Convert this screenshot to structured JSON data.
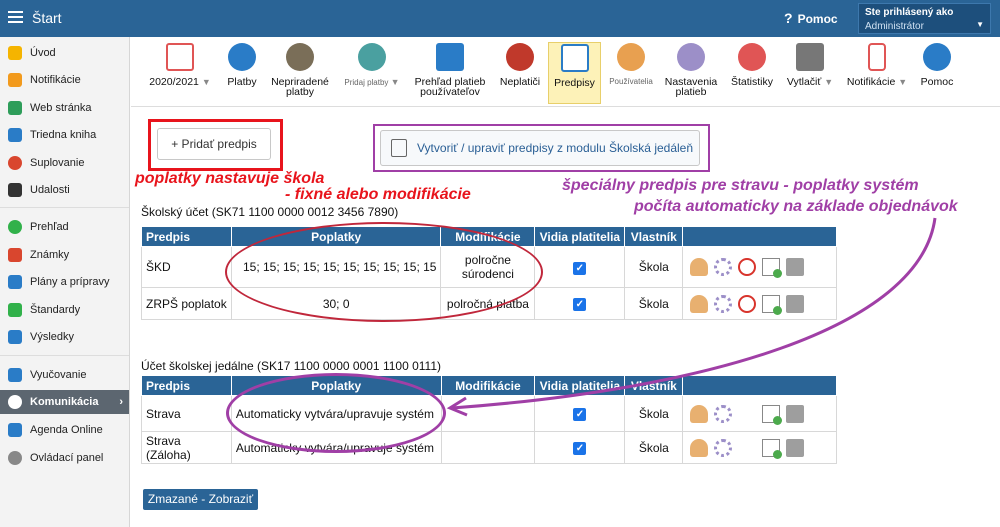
{
  "header": {
    "title": "Štart",
    "help": "Pomoc",
    "user_label": "Ste prihlásený ako",
    "user_name": "Administrátor"
  },
  "sidebar": {
    "items": [
      {
        "label": "Úvod",
        "icon": "star-icon",
        "color": "#f5b400"
      },
      {
        "label": "Notifikácie",
        "icon": "envelope-icon",
        "color": "#f29a1d"
      },
      {
        "label": "Web stránka",
        "icon": "home-icon",
        "color": "#2e9d5a"
      },
      {
        "label": "Triedna kniha",
        "icon": "book-icon",
        "color": "#2a7cc7"
      },
      {
        "label": "Suplovanie",
        "icon": "person-icon",
        "color": "#d9462e"
      },
      {
        "label": "Udalosti",
        "icon": "calendar-icon",
        "color": "#333333"
      },
      {
        "label": "Prehľad",
        "icon": "check-circle-icon",
        "color": "#31b14a"
      },
      {
        "label": "Známky",
        "icon": "grade-icon",
        "color": "#d9462e"
      },
      {
        "label": "Plány a prípravy",
        "icon": "briefcase-icon",
        "color": "#2a7cc7"
      },
      {
        "label": "Štandardy",
        "icon": "shield-icon",
        "color": "#31b14a"
      },
      {
        "label": "Výsledky",
        "icon": "bar-chart-icon",
        "color": "#2a7cc7"
      },
      {
        "label": "Vyučovanie",
        "icon": "classroom-icon",
        "color": "#2a7cc7"
      },
      {
        "label": "Komunikácia",
        "icon": "chat-icon",
        "color": "#ffffff"
      },
      {
        "label": "Agenda Online",
        "icon": "pen-icon",
        "color": "#2a7cc7"
      },
      {
        "label": "Ovládací panel",
        "icon": "gear-icon",
        "color": "#888888"
      }
    ]
  },
  "toolbar": {
    "items": [
      {
        "label": "2020/2021",
        "icon": "calendar-icon",
        "color": "#e05555"
      },
      {
        "label": "Platby",
        "icon": "money-bag-icon",
        "color": "#2a7cc7"
      },
      {
        "label": "Nepriradené platby",
        "icon": "question-bag-icon",
        "color": "#7a6e58"
      },
      {
        "label": "Pridaj platby",
        "icon": "add-money-icon",
        "color": "#4aa0a0"
      },
      {
        "label": "Prehľad platieb používateľov",
        "icon": "ledger-icon",
        "color": "#2a7cc7"
      },
      {
        "label": "Neplatiči",
        "icon": "debt-bag-icon",
        "color": "#c0392b"
      },
      {
        "label": "Predpisy",
        "icon": "document-icon",
        "color": "#2a7cc7"
      },
      {
        "label": "Používatelia",
        "icon": "user-icon",
        "color": "#e8a050"
      },
      {
        "label": "Nastavenia platieb",
        "icon": "gear-icon",
        "color": "#9c8fc8"
      },
      {
        "label": "Štatistiky",
        "icon": "pie-chart-icon",
        "color": "#e05555"
      },
      {
        "label": "Vytlačiť",
        "icon": "printer-icon",
        "color": "#777777"
      },
      {
        "label": "Notifikácie",
        "icon": "phone-icon",
        "color": "#e05555"
      },
      {
        "label": "Pomoc",
        "icon": "help-icon",
        "color": "#2a7cc7"
      }
    ]
  },
  "actions": {
    "add": "+ Pridať predpis",
    "canteen": "Vytvoriť / upraviť predpisy z modulu Školská jedáleň",
    "deleted": "Zmazané - Zobraziť"
  },
  "annotations": {
    "red1": "poplatky nastavuje škola",
    "red2": "- fixné alebo modifikácie",
    "purple1": "špeciálny predpis pre stravu - poplatky systém",
    "purple2": "počíta automaticky na základe objednávok"
  },
  "accounts": {
    "school": "Školský účet (SK71 1100 0000 0012 3456 7890)",
    "canteen": "Účet školskej jedálne (SK17 1100 0000 0001 1100 0111)"
  },
  "table": {
    "headers": [
      "Predpis",
      "Poplatky",
      "Modifikácie",
      "Vidia platitelia",
      "Vlastník"
    ]
  },
  "rows_school": [
    {
      "name": "ŠKD",
      "fees": "15; 15; 15; 15; 15; 15; 15; 15; 15; 15",
      "mod": "polročne súrodenci",
      "visible": "✓",
      "owner": "Škola"
    },
    {
      "name": "ZRPŠ poplatok",
      "fees": "30; 0",
      "mod": "polročná platba",
      "visible": "✓",
      "owner": "Škola"
    }
  ],
  "rows_canteen": [
    {
      "name": "Strava",
      "fees": "Automaticky vytvára/upravuje systém",
      "mod": "",
      "visible": "✓",
      "owner": "Škola"
    },
    {
      "name": "Strava (Záloha)",
      "fees": "Automaticky vytvára/upravuje systém",
      "mod": "",
      "visible": "✓",
      "owner": "Škola"
    }
  ]
}
